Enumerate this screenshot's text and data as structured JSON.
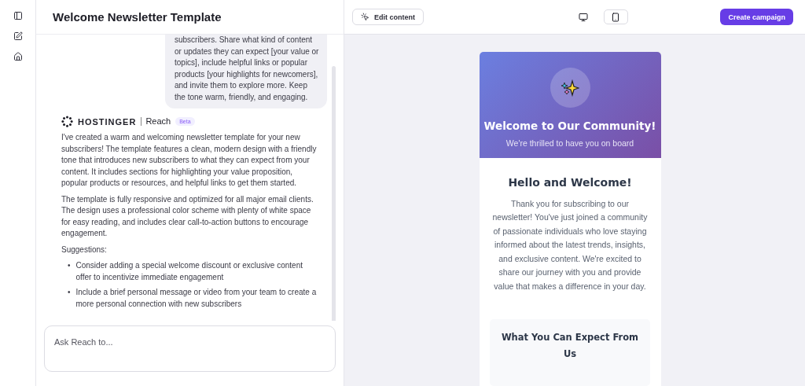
{
  "chat": {
    "title": "Welcome Newsletter Template",
    "messages": [
      {
        "kind": "user",
        "text": "subscribers. Share what kind of content or updates they can expect [your value or topics], include helpful links or popular products [your highlights for newcomers], and invite them to explore more. Keep the tone warm, friendly, and engaging."
      },
      {
        "kind": "assistant",
        "brand": "HOSTINGER",
        "product": "Reach",
        "badge": "Beta",
        "paragraphs": [
          "I've created a warm and welcoming newsletter template for your new subscribers! The template features a clean, modern design with a friendly tone that introduces new subscribers to what they can expect from your content. It includes sections for highlighting your value proposition, popular products or resources, and helpful links to get them started.",
          "The template is fully responsive and optimized for all major email clients. The design uses a professional color scheme with plenty of white space for easy reading, and includes clear call-to-action buttons to encourage engagement.",
          "Suggestions:"
        ],
        "bullet": "•",
        "suggestions": [
          "Consider adding a special welcome discount or exclusive content offer to incentivize immediate engagement",
          "Include a brief personal message or video from your team to create a more personal connection with new subscribers"
        ]
      }
    ],
    "input": {
      "placeholder": "Ask Reach to..."
    }
  },
  "toolbar": {
    "edit_button": "Edit content",
    "devices": [
      {
        "kind": "desktop",
        "selected": false
      },
      {
        "kind": "mobile",
        "selected": true
      }
    ],
    "create_button": "Create campaign"
  },
  "email": {
    "title": "Welcome to Our Community!",
    "subtitle": "We're thrilled to have you on board",
    "heading": "Hello and Welcome!",
    "body": "Thank you for subscribing to our newsletter! You've just joined a community of passionate individuals who love staying informed about the latest trends, insights, and exclusive content. We're excited to share our journey with you and provide value that makes a difference in your day.",
    "section_title": "What You Can Expect From Us"
  }
}
